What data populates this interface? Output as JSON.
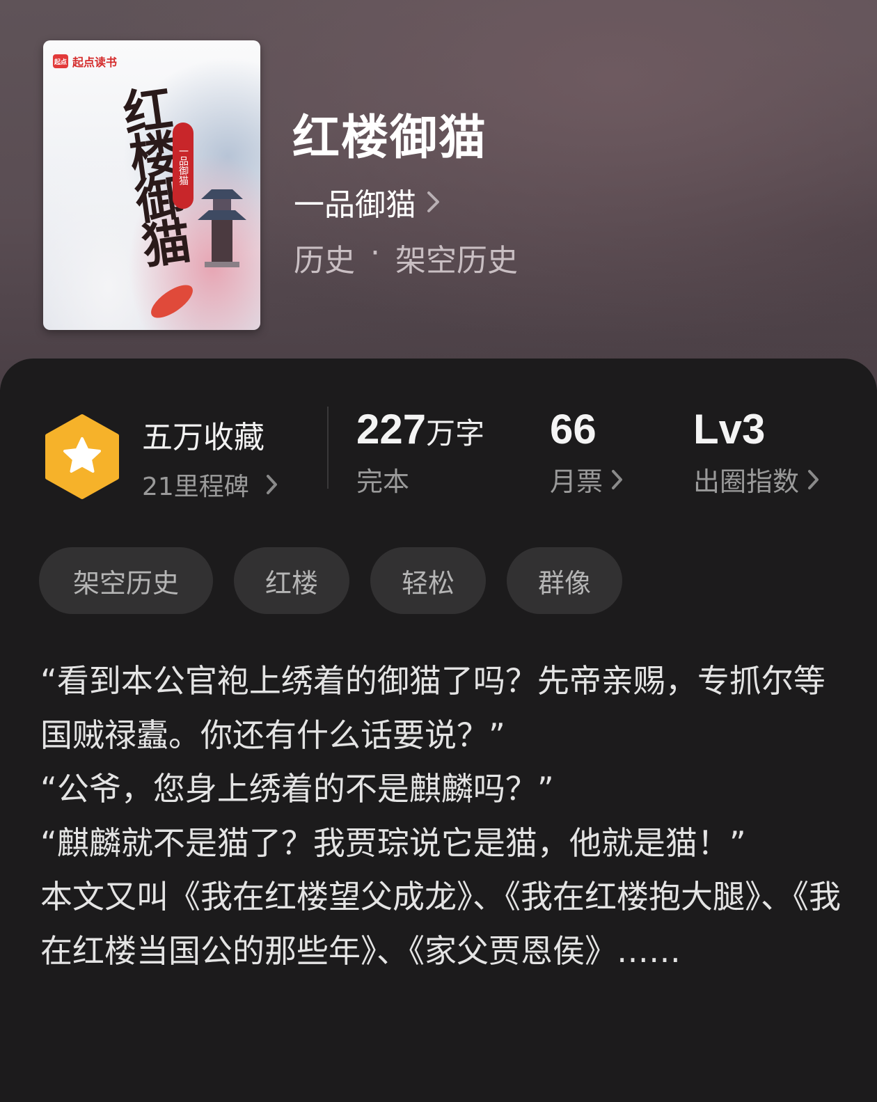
{
  "book": {
    "title": "红楼御猫",
    "author": "一品御猫",
    "category": "历史",
    "subcategory": "架空历史",
    "category_separator": "·"
  },
  "cover": {
    "brand": "起点读书",
    "brand_mark": "起点",
    "title": "红楼御猫",
    "author_seal": "一品御猫"
  },
  "stats": {
    "collection": {
      "main": "五万收藏",
      "sub": "21里程碑",
      "icon": "star-badge-icon",
      "badge_color": "#f6b22a"
    },
    "words": {
      "value": "227",
      "unit": "万字",
      "label": "完本"
    },
    "votes": {
      "value": "66",
      "label": "月票"
    },
    "level": {
      "value": "Lv3",
      "label": "出圈指数"
    }
  },
  "tags": [
    "架空历史",
    "红楼",
    "轻松",
    "群像"
  ],
  "synopsis": [
    "“看到本公官袍上绣着的御猫了吗？先帝亲赐，专抓尔等国贼禄蠹。你还有什么话要说？”",
    "“公爷，您身上绣着的不是麒麟吗？”",
    "“麒麟就不是猫了？我贾琮说它是猫，他就是猫！”",
    "本文又叫《我在红楼望父成龙》、《我在红楼抱大腿》、《我在红楼当国公的那些年》、《家父贾恩侯》……"
  ]
}
